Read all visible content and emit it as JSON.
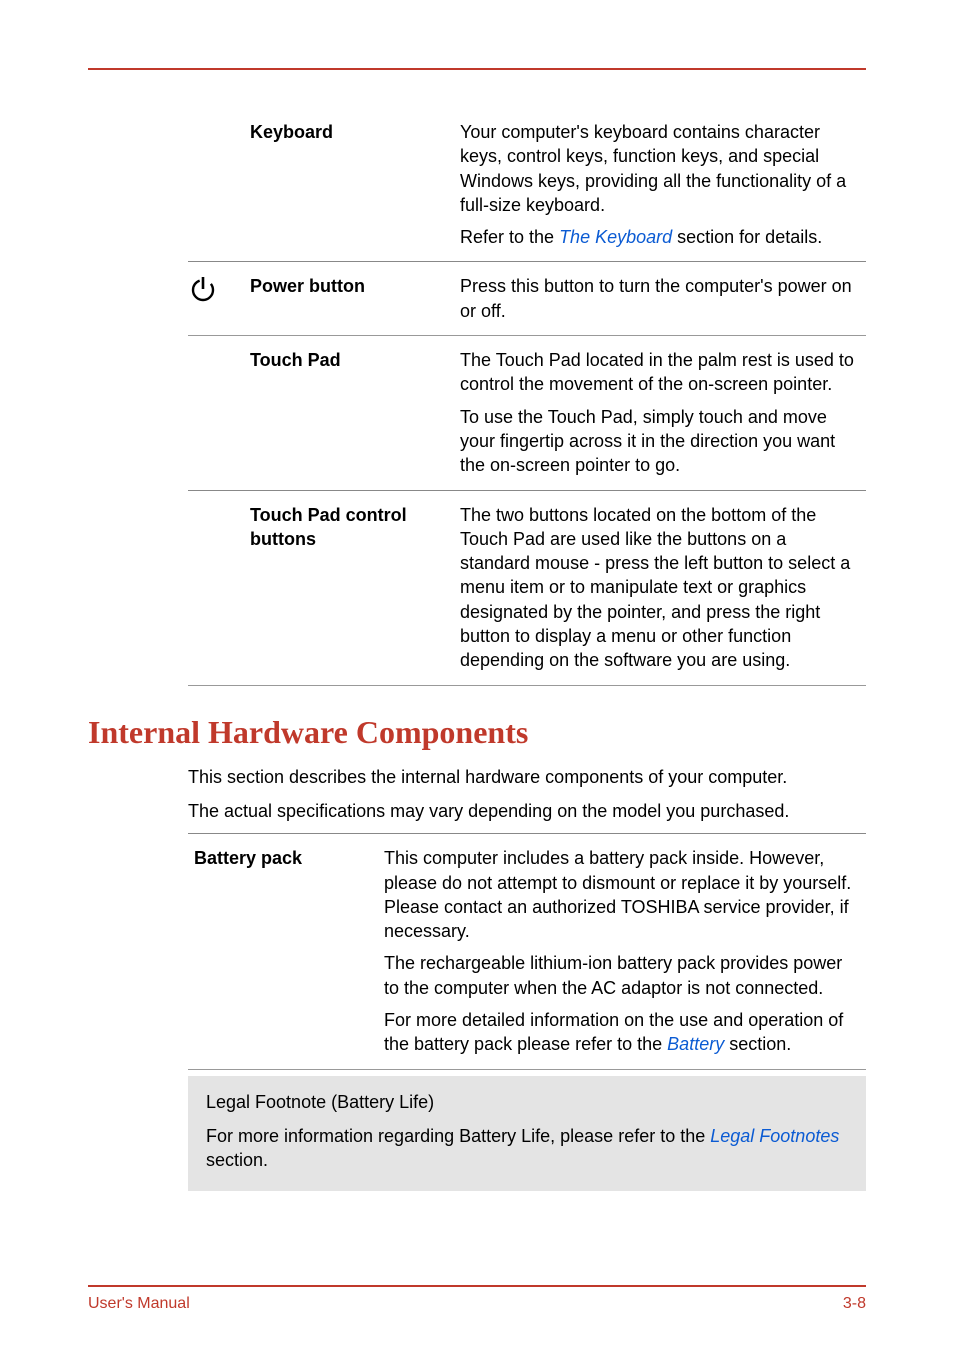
{
  "defs": {
    "keyboard": {
      "label": "Keyboard",
      "p1": "Your computer's keyboard contains character keys, control keys, function keys, and special Windows keys, providing all the functionality of a full-size keyboard.",
      "p2a": "Refer to the ",
      "p2link": "The Keyboard",
      "p2b": " section for details."
    },
    "power": {
      "label": "Power button",
      "p1": "Press this button to turn the computer's power on or off."
    },
    "touchpad": {
      "label": "Touch Pad",
      "p1": "The Touch Pad located in the palm rest is used to control the movement of the on-screen pointer.",
      "p2": "To use the Touch Pad, simply touch and move your fingertip across it in the direction you want the on-screen pointer to go."
    },
    "tpcontrol": {
      "label": "Touch Pad control buttons",
      "p1": "The two buttons located on the bottom of the Touch Pad are used like the buttons on a standard mouse - press the left button to select a menu item or to manipulate text or graphics designated by the pointer, and press the right button to display a menu or other function depending on the software you are using."
    }
  },
  "heading": "Internal Hardware Components",
  "intro1": "This section describes the internal hardware components of your computer.",
  "intro2": "The actual specifications may vary depending on the model you purchased.",
  "battery": {
    "label": "Battery pack",
    "p1": "This computer includes a battery pack inside. However, please do not attempt to dismount or replace it by yourself. Please contact an authorized TOSHIBA service provider, if necessary.",
    "p2": "The rechargeable lithium-ion battery pack provides power to the computer when the AC adaptor is not connected.",
    "p3a": "For more detailed information on the use and operation of the battery pack please refer to the ",
    "p3link": "Battery",
    "p3b": " section."
  },
  "note": {
    "title": "Legal Footnote (Battery Life)",
    "p_a": "For more information regarding Battery Life, please refer to the ",
    "p_link": "Legal Footnotes",
    "p_b": " section."
  },
  "footer": {
    "left": "User's Manual",
    "right": "3-8"
  }
}
